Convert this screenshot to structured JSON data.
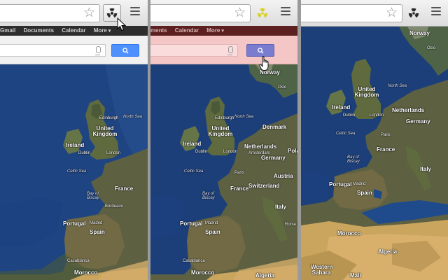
{
  "gbar_links": [
    "Gmail",
    "Documents",
    "Calendar",
    "More"
  ],
  "gbar_links_panel2": [
    "ments",
    "Calendar",
    "More"
  ],
  "icons": {
    "bookmark": "star-icon",
    "extension": "radiation-icon",
    "menu": "hamburger-menu-icon",
    "microphone": "microphone-icon",
    "search": "magnifier-icon",
    "cursor_panel1": "arrow-cursor",
    "cursor_panel2": "hand-cursor"
  },
  "colors": {
    "search_button": "#4d90fe",
    "search_button_tinted": "#7a7ccf",
    "gbar_dark": "#2d2d2d",
    "gbar_tinted": "#5c2020",
    "search_area_tinted": "#f4c6c6",
    "radiation_active": "#d8d020",
    "ocean": "#1c3f7a",
    "land": "#5e6340",
    "desert": "#c8a35c"
  },
  "map_labels_panel1": {
    "countries": [
      "United Kingdom",
      "Ireland",
      "France",
      "Portugal",
      "Spain",
      "Morocco"
    ],
    "seas": [
      "North Sea",
      "Celtic Sea",
      "Bay of Biscay"
    ],
    "cities": [
      "Edinburgh",
      "Dublin",
      "London",
      "Bordeaux",
      "Madrid",
      "Casablanca"
    ]
  },
  "map_labels_panel2": {
    "countries": [
      "Norway",
      "Denmark",
      "Netherlands",
      "Germany",
      "Poland",
      "Austria",
      "Italy",
      "Switzerland",
      "United Kingdom",
      "Ireland",
      "France",
      "Portugal",
      "Spain",
      "Morocco",
      "Algeria"
    ],
    "seas": [
      "North Sea",
      "Celtic Sea",
      "Bay of Biscay"
    ],
    "cities": [
      "Oslo",
      "Edinburgh",
      "Dublin",
      "London",
      "Amsterdam",
      "Paris",
      "Rome",
      "Madrid",
      "Casablanca"
    ]
  },
  "map_labels_panel3": {
    "countries": [
      "Norway",
      "United Kingdom",
      "Ireland",
      "Netherlands",
      "Germany",
      "France",
      "Italy",
      "Portugal",
      "Spain",
      "Morocco",
      "Algeria",
      "Western Sahara",
      "Mali"
    ],
    "seas": [
      "North Sea",
      "Celtic Sea",
      "Bay of Biscay"
    ],
    "cities": [
      "Oslo",
      "Dublin",
      "London",
      "Paris",
      "Madrid"
    ]
  }
}
